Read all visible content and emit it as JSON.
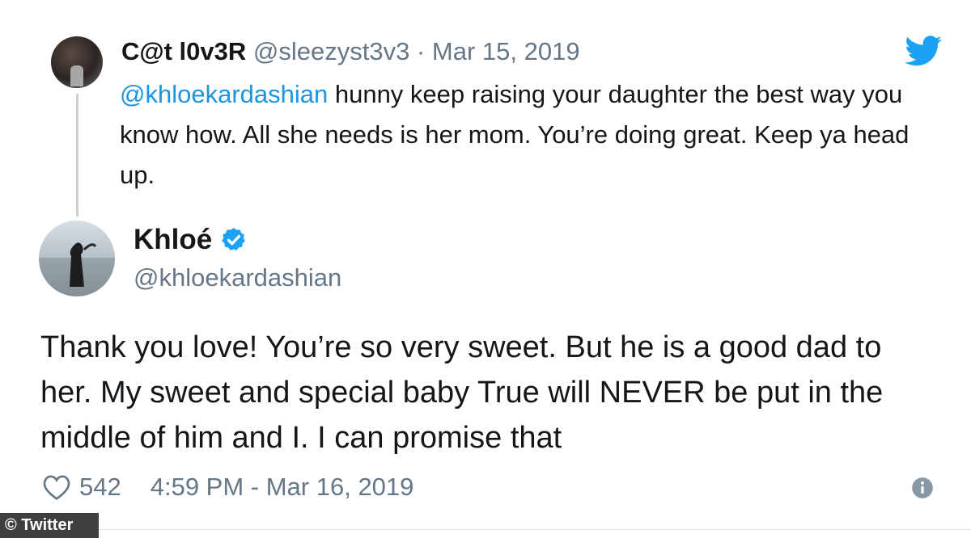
{
  "parent_tweet": {
    "display_name": "C@t l0v3R",
    "handle": "@sleezyst3v3",
    "separator": "·",
    "date": "Mar 15, 2019",
    "mention": "@khloekardashian",
    "text": " hunny keep raising your daughter the best way you know how. All she needs is her mom. You’re doing great. Keep ya head up."
  },
  "main_tweet": {
    "display_name": "Khloé",
    "handle": "@khloekardashian",
    "text": "Thank you love! You’re so very sweet.     But he is a good dad to her. My sweet and special baby True will NEVER be put in the middle of him and I. I can promise that",
    "likes": "542",
    "timestamp": "4:59 PM - Mar 16, 2019"
  },
  "credit": "© Twitter",
  "colors": {
    "twitter_blue": "#1da1f2",
    "mention": "#1b95e0",
    "secondary_text": "#657786",
    "primary_text": "#14171a"
  },
  "icons": {
    "brand": "twitter-bird-icon",
    "verified": "verified-badge-icon",
    "like": "heart-outline-icon",
    "info": "info-icon"
  }
}
